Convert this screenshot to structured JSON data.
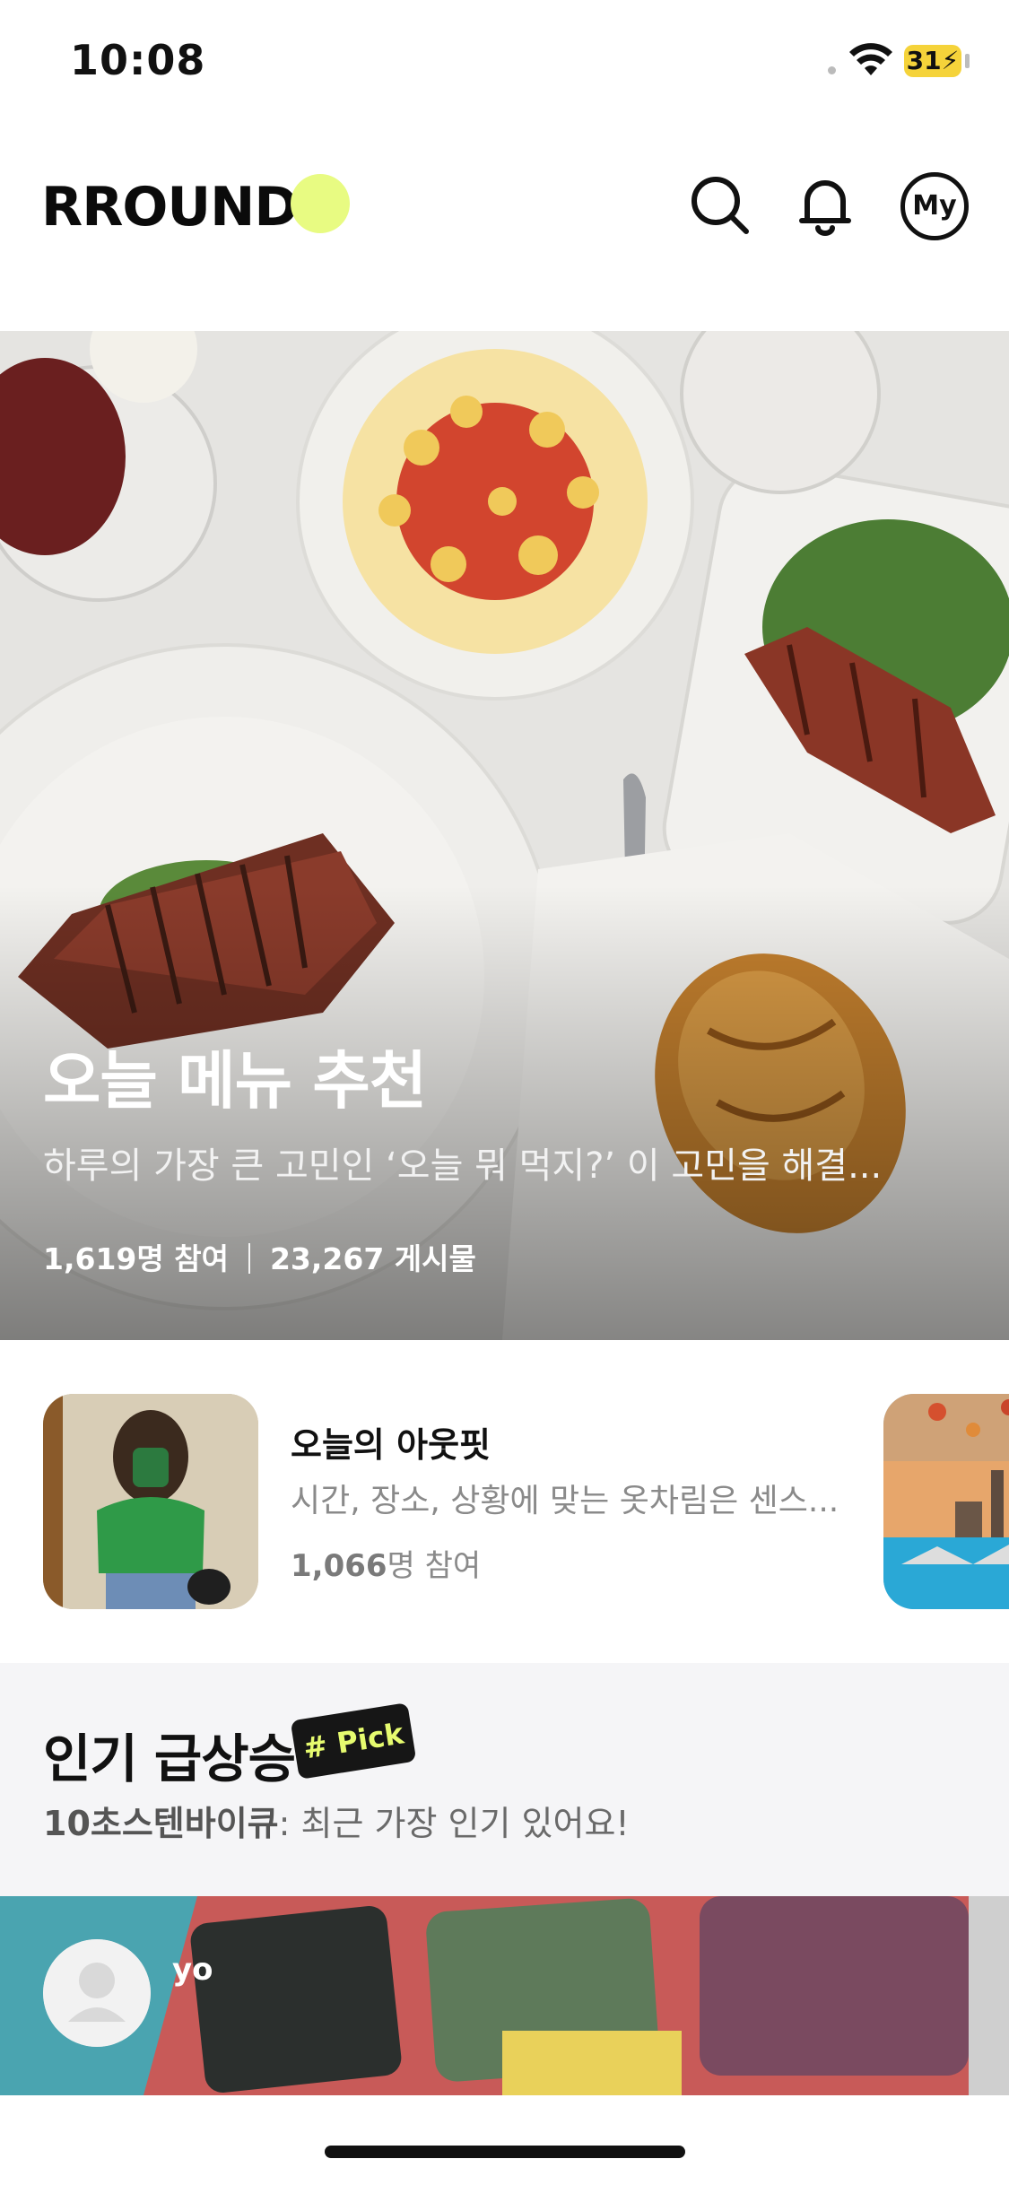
{
  "status_bar": {
    "time": "10:08",
    "battery": "31"
  },
  "header": {
    "logo": "RROUND",
    "my_label": "My"
  },
  "hero": {
    "title": "오늘 메뉴 추천",
    "description": "하루의 가장 큰 고민인 ‘오늘 뭐 먹지?’ 이 고민을 해결...",
    "participants": "1,619명 참여",
    "posts": "23,267 게시물"
  },
  "card": {
    "title": "오늘의 아웃핏",
    "description": "시간, 장소, 상황에 맞는 옷차림은 센스...",
    "count_number": "1,066",
    "count_suffix": "명 참여"
  },
  "trending": {
    "title": "인기 급상승",
    "badge": "# Pick",
    "sub_bold": "10초스텐바이큐",
    "sub_rest": ": 최근 가장 인기 있어요!"
  },
  "post": {
    "username": "yo"
  },
  "colors": {
    "accent": "#e8fb82",
    "badge_bg": "#161616",
    "badge_text": "#e6fb6f"
  }
}
